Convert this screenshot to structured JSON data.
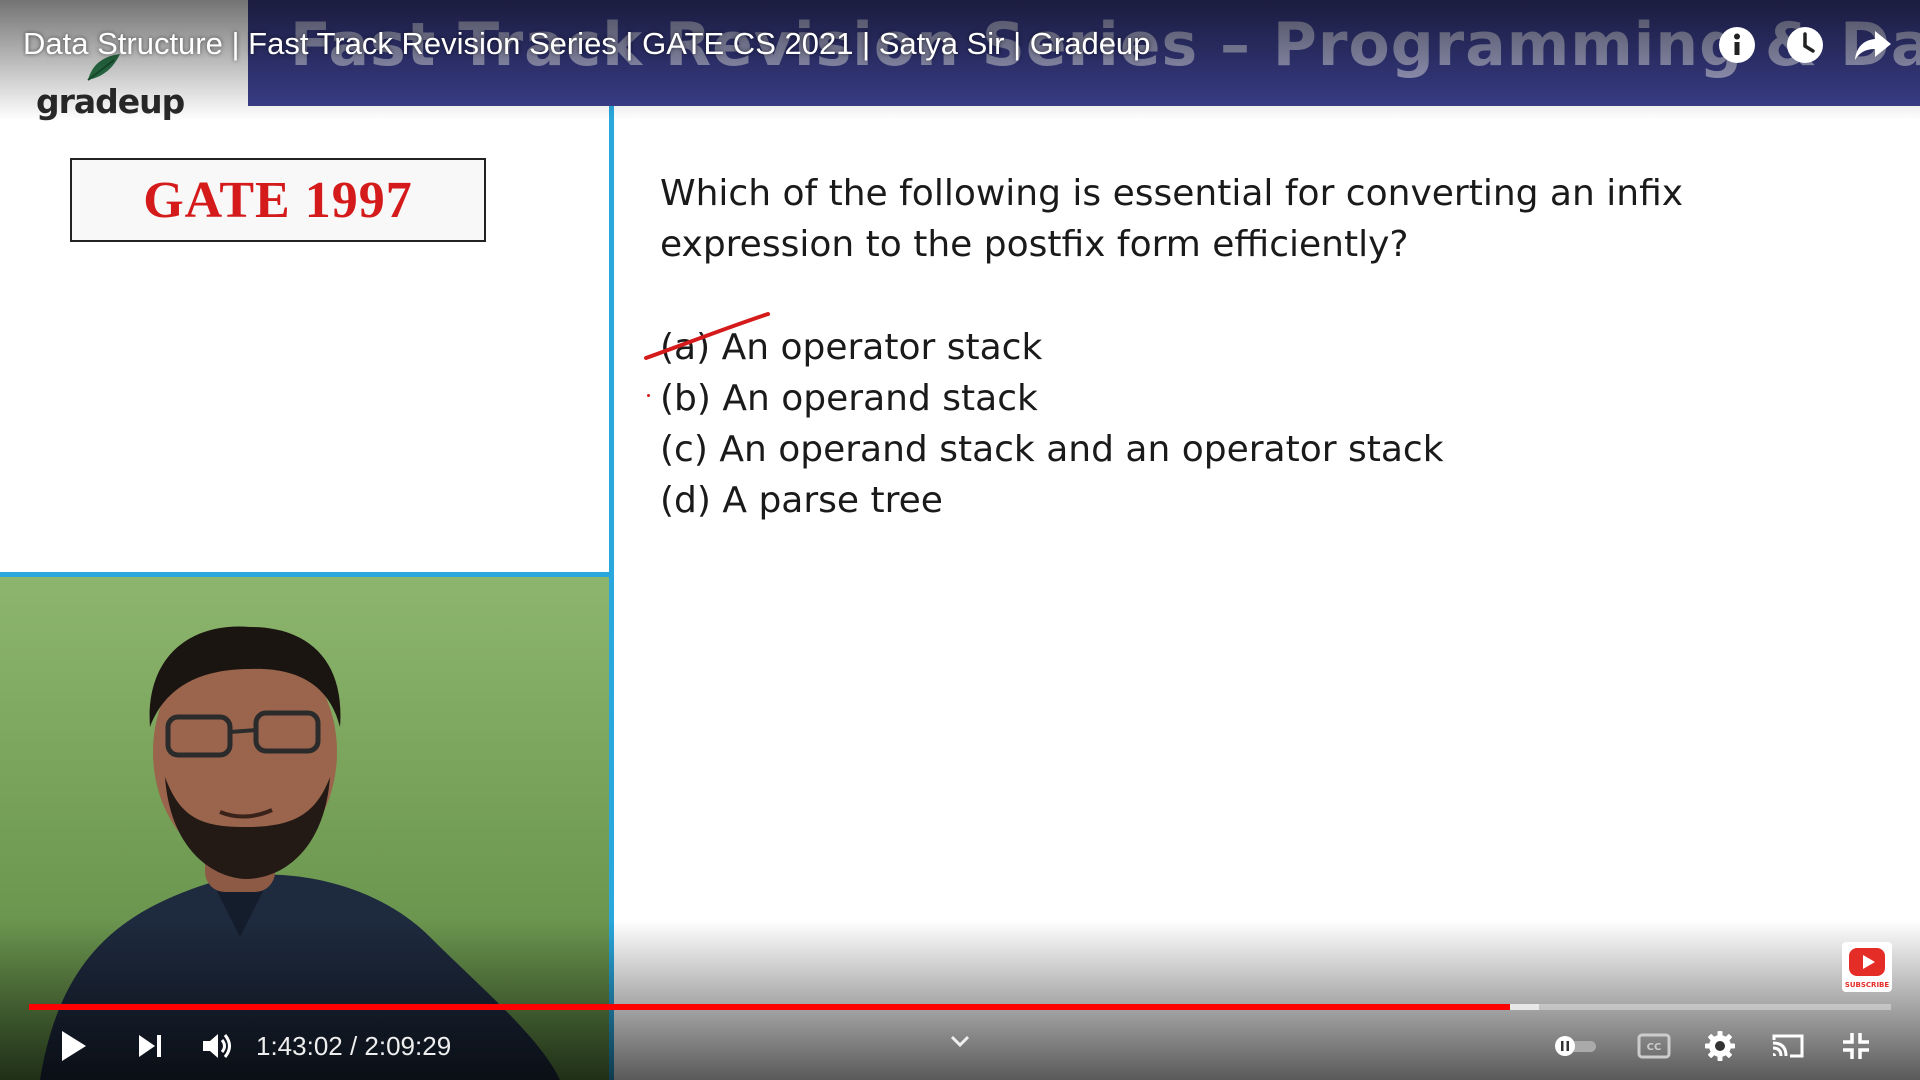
{
  "video": {
    "title": "Data Structure | Fast Track Revision Series | GATE CS 2021 | Satya Sir | Gradeup",
    "current_time": "1:43:02",
    "duration": "2:09:29",
    "time_display": "1:43:02 / 2:09:29",
    "progress_fraction": 0.7955,
    "buffered_fraction": 0.811
  },
  "slide": {
    "banner_text": "Fast Track Revision Series – Programming & Data Structures",
    "logo_text": "gradeup",
    "exam_tag": "GATE 1997",
    "question": "Which of the following is essential for converting an infix expression to the postfix form efficiently?",
    "options": [
      "(a) An operator stack",
      "(b) An operand stack",
      "(c) An operand stack and an operator stack",
      "(d) A parse tree"
    ]
  },
  "subscribe_badge": {
    "label": "SUBSCRIBE"
  },
  "colors": {
    "progress_played": "#ff0000",
    "banner": "#3b3f8c",
    "exam_tag": "#d41a1a",
    "divider": "#2aa7dc",
    "annotation": "#d41a1a"
  },
  "icons": {
    "info": "info-icon",
    "watch_later": "clock-icon",
    "share": "share-icon",
    "play": "play-icon",
    "next": "next-icon",
    "volume": "volume-icon",
    "chevron": "chevron-down-icon",
    "autoplay": "autoplay-toggle-icon",
    "captions": "captions-icon",
    "settings": "gear-icon",
    "cast": "cast-icon",
    "fullscreen_exit": "exit-fullscreen-icon"
  }
}
